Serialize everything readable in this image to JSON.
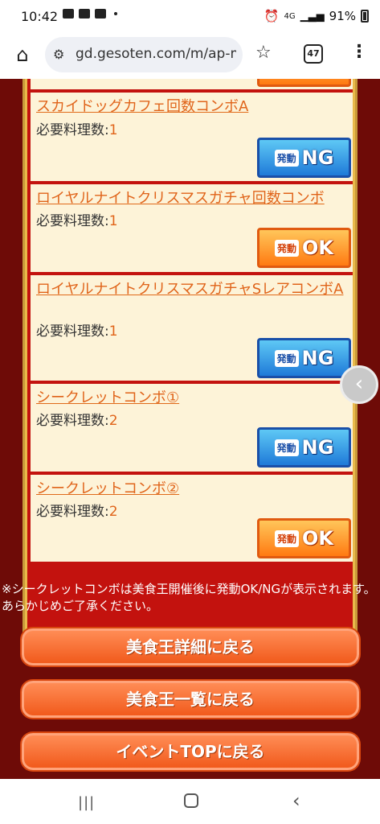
{
  "status": {
    "time": "10:42",
    "network": "4G",
    "battery": "91%"
  },
  "browser": {
    "url": "gd.gesoten.com/m/ap-m",
    "tab_count": "47"
  },
  "items": [
    {
      "name": "スカイドッグカフェ回数コンボA",
      "req_label": "必要料理数:",
      "req_num": "1",
      "status_kanji": "発動",
      "status": "NG"
    },
    {
      "name": "ロイヤルナイトクリスマスガチャ回数コンボ",
      "req_label": "必要料理数:",
      "req_num": "1",
      "status_kanji": "発動",
      "status": "OK"
    },
    {
      "name": "ロイヤルナイトクリスマスガチャSレアコンボA",
      "req_label": "必要料理数:",
      "req_num": "1",
      "status_kanji": "発動",
      "status": "NG"
    },
    {
      "name": "シークレットコンボ①",
      "req_label": "必要料理数:",
      "req_num": "2",
      "status_kanji": "発動",
      "status": "NG"
    },
    {
      "name": "シークレットコンボ②",
      "req_label": "必要料理数:",
      "req_num": "2",
      "status_kanji": "発動",
      "status": "OK"
    }
  ],
  "note": "※シークレットコンボは美食王開催後に発動OK/NGが表示されます。あらかじめご了承ください。",
  "buttons": {
    "back_detail": "美食王詳細に戻る",
    "back_list": "美食王一覧に戻る",
    "back_event_top": "イベントTOPに戻る"
  },
  "colors": {
    "background": "#6e0b07",
    "item_link": "#e0641a",
    "ok": "#ff7a12",
    "ng": "#1f7ad8"
  }
}
